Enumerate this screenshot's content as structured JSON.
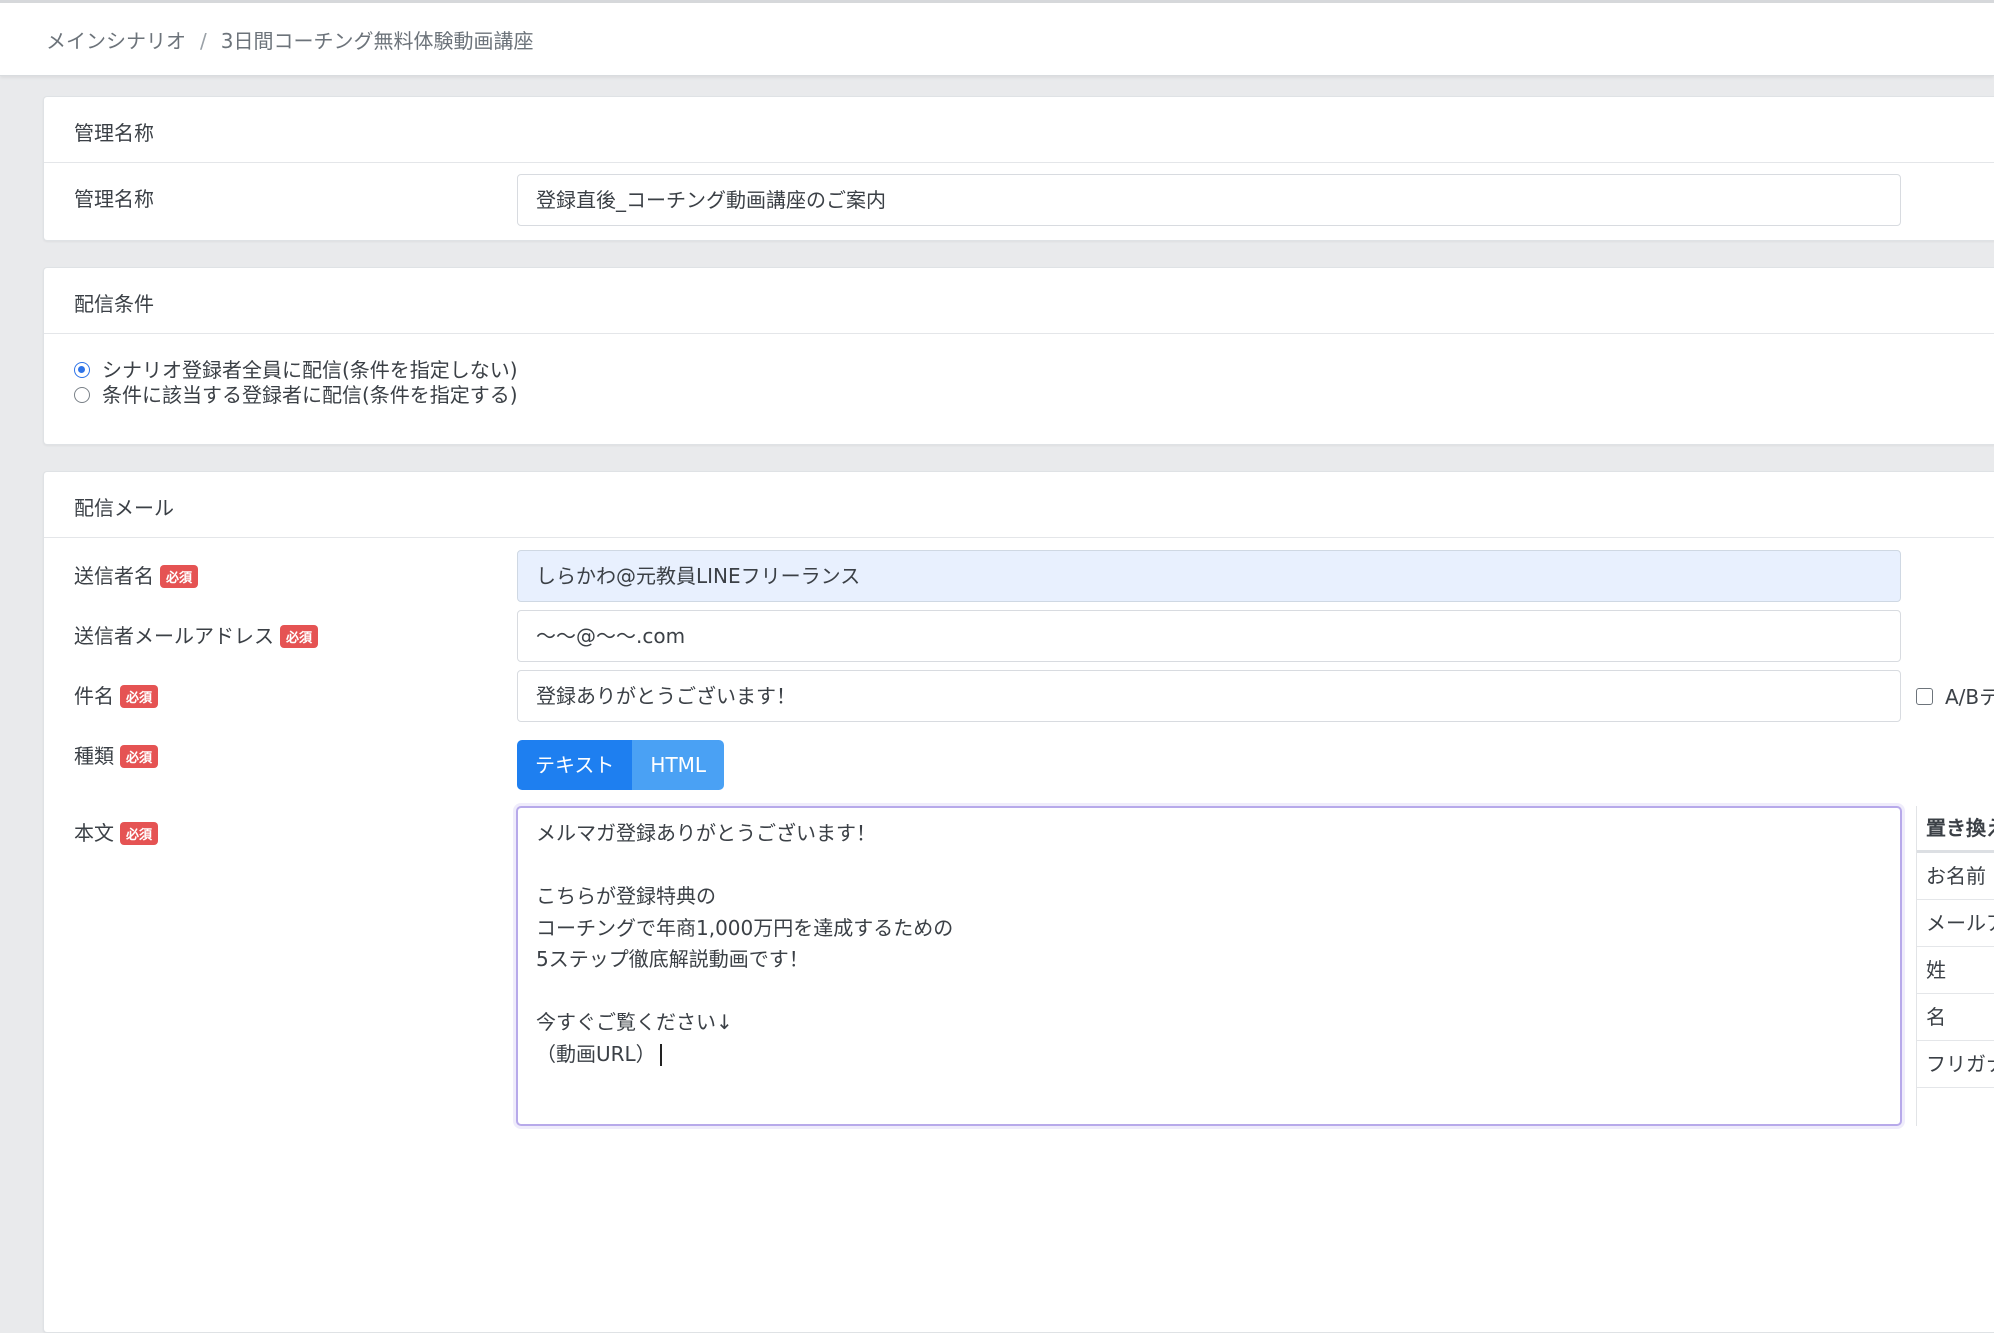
{
  "breadcrumb": {
    "items": [
      "メインシナリオ",
      "3日間コーチング無料体験動画講座"
    ],
    "separator": "/"
  },
  "admin_name_card": {
    "header": "管理名称",
    "label": "管理名称",
    "value": "登録直後_コーチング動画講座のご案内"
  },
  "delivery_condition_card": {
    "header": "配信条件",
    "options": [
      {
        "label": "シナリオ登録者全員に配信(条件を指定しない)",
        "checked": true
      },
      {
        "label": "条件に該当する登録者に配信(条件を指定する)",
        "checked": false
      }
    ]
  },
  "delivery_mail_card": {
    "header": "配信メール",
    "required_badge": "必須",
    "sender_name": {
      "label": "送信者名",
      "value": "しらかわ@元教員LINEフリーランス"
    },
    "sender_email": {
      "label": "送信者メールアドレス",
      "value": "〜〜@〜〜.com"
    },
    "subject": {
      "label": "件名",
      "value": "登録ありがとうございます！",
      "ab_test_label": "A/Bテスト"
    },
    "type": {
      "label": "種類",
      "options": [
        "テキスト",
        "HTML"
      ],
      "selected": "テキスト"
    },
    "body": {
      "label": "本文",
      "lines": [
        "メルマガ登録ありがとうございます！",
        "",
        "こちらが登録特典の",
        "コーチングで年商1,000万円を達成するための",
        "5ステップ徹底解説動画です！",
        "",
        "今すぐご覧ください↓",
        "（動画URL）"
      ]
    },
    "replacement_panel": {
      "header": "置き換え文字",
      "items": [
        "お名前",
        "メールアドレス",
        "姓",
        "名",
        "フリガナ"
      ]
    }
  },
  "colors": {
    "accent": "#1e7ff0",
    "badge": "#e55353",
    "page_background": "#e9eaec",
    "filled_input": "#e8f0fe"
  }
}
